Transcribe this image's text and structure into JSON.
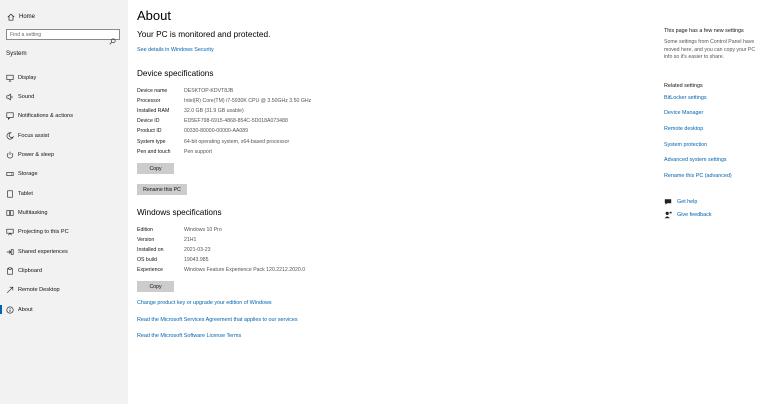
{
  "sidebar": {
    "home_label": "Home",
    "search_placeholder": "Find a setting",
    "section_label": "System",
    "items": [
      {
        "label": "Display",
        "icon": "display-icon"
      },
      {
        "label": "Sound",
        "icon": "sound-icon"
      },
      {
        "label": "Notifications & actions",
        "icon": "notifications-icon"
      },
      {
        "label": "Focus assist",
        "icon": "focus-assist-icon"
      },
      {
        "label": "Power & sleep",
        "icon": "power-icon"
      },
      {
        "label": "Storage",
        "icon": "storage-icon"
      },
      {
        "label": "Tablet",
        "icon": "tablet-icon"
      },
      {
        "label": "Multitasking",
        "icon": "multitasking-icon"
      },
      {
        "label": "Projecting to this PC",
        "icon": "projecting-icon"
      },
      {
        "label": "Shared experiences",
        "icon": "shared-experiences-icon"
      },
      {
        "label": "Clipboard",
        "icon": "clipboard-icon"
      },
      {
        "label": "Remote Desktop",
        "icon": "remote-desktop-icon"
      },
      {
        "label": "About",
        "icon": "info-icon",
        "selected": true
      }
    ]
  },
  "main": {
    "title": "About",
    "protection_status": "Your PC is monitored and protected.",
    "security_link": "See details in Windows Security",
    "device_specs": {
      "heading": "Device specifications",
      "rows": [
        {
          "key": "Device name",
          "value": "DESKTOP-KDVT8JB"
        },
        {
          "key": "Processor",
          "value": "Intel(R) Core(TM) i7-5930K CPU @ 3.50GHz   3.50 GHz"
        },
        {
          "key": "Installed RAM",
          "value": "32.0 GB (31.9 GB usable)"
        },
        {
          "key": "Device ID",
          "value": "ED5EF798-6915-4868-854C-5D018A073488"
        },
        {
          "key": "Product ID",
          "value": "00330-80000-00000-AA089"
        },
        {
          "key": "System type",
          "value": "64-bit operating system, x64-based processor"
        },
        {
          "key": "Pen and touch",
          "value": "Pen support"
        }
      ],
      "copy_label": "Copy",
      "rename_label": "Rename this PC"
    },
    "windows_specs": {
      "heading": "Windows specifications",
      "rows": [
        {
          "key": "Edition",
          "value": "Windows 10 Pro"
        },
        {
          "key": "Version",
          "value": "21H1"
        },
        {
          "key": "Installed on",
          "value": "2021-03-23"
        },
        {
          "key": "OS build",
          "value": "19043.985"
        },
        {
          "key": "Experience",
          "value": "Windows Feature Experience Pack 120.2212.2020.0"
        }
      ],
      "copy_label": "Copy"
    },
    "links": [
      "Change product key or upgrade your edition of Windows",
      "Read the Microsoft Services Agreement that applies to our services",
      "Read the Microsoft Software License Terms"
    ]
  },
  "right_panel": {
    "heading": "This page has a few new settings",
    "description": "Some settings from Control Panel have moved here, and you can copy your PC info so it's easier to share.",
    "related_heading": "Related settings",
    "related_links": [
      "BitLocker settings",
      "Device Manager",
      "Remote desktop",
      "System protection",
      "Advanced system settings",
      "Rename this PC (advanced)"
    ],
    "get_help": "Get help",
    "give_feedback": "Give feedback"
  },
  "colors": {
    "accent": "#0063b1",
    "sidebar_bg": "#f2f2f2",
    "button_bg": "#cccccc"
  }
}
